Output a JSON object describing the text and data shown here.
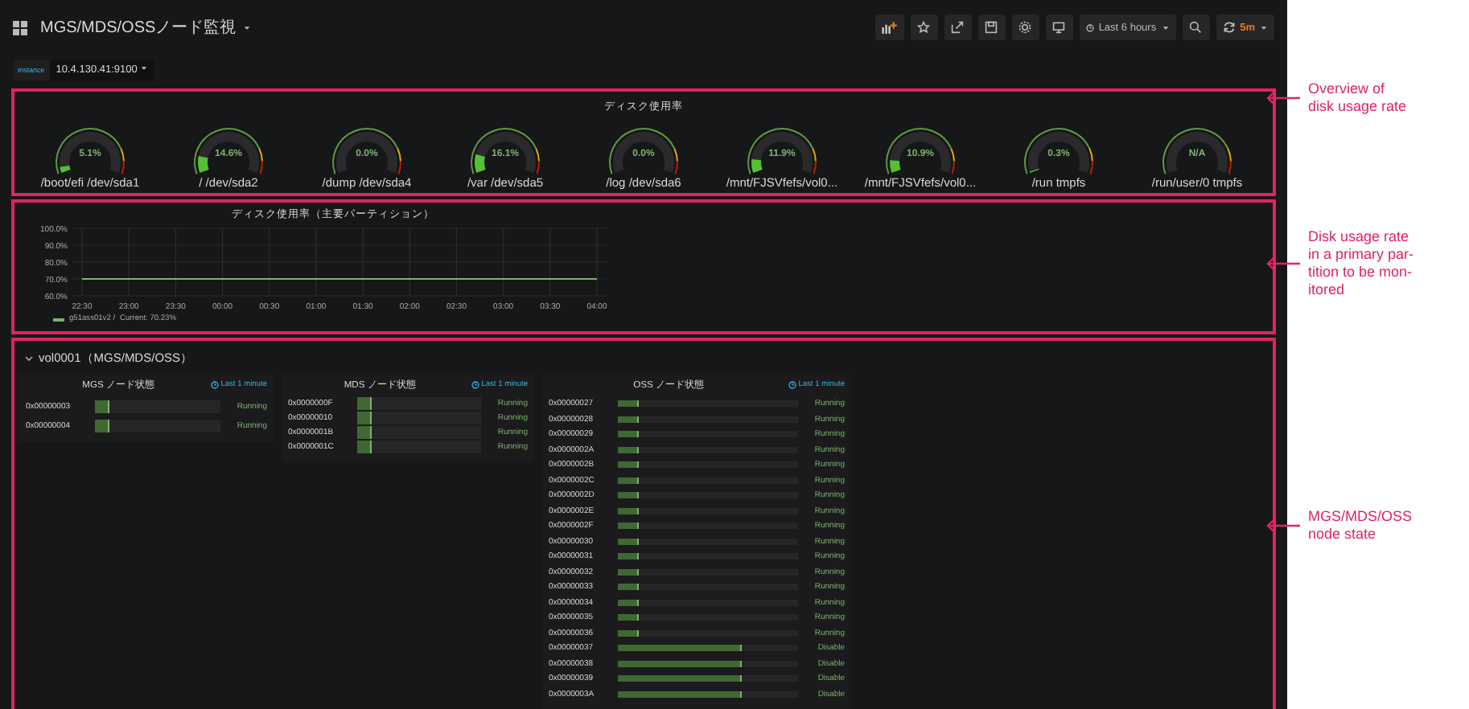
{
  "dashboard": {
    "title": "MGS/MDS/OSSノード監視",
    "toolbar": {
      "time_range": "Last 6 hours",
      "refresh": "5m"
    },
    "variables": [
      {
        "label": "instance",
        "value": "10.4.130.41:9100"
      }
    ],
    "gauge_panel": {
      "title": "ディスク使用率",
      "gauges": [
        {
          "value": "5.1%",
          "label": "/boot/efi /dev/sda1"
        },
        {
          "value": "14.6%",
          "label": "/ /dev/sda2"
        },
        {
          "value": "0.0%",
          "label": "/dump /dev/sda4"
        },
        {
          "value": "16.1%",
          "label": "/var /dev/sda5"
        },
        {
          "value": "0.0%",
          "label": "/log /dev/sda6"
        },
        {
          "value": "11.9%",
          "label": "/mnt/FJSVfefs/vol0..."
        },
        {
          "value": "10.9%",
          "label": "/mnt/FJSVfefs/vol0..."
        },
        {
          "value": "0.3%",
          "label": "/run tmpfs"
        },
        {
          "value": "N/A",
          "label": "/run/user/0 tmpfs"
        }
      ]
    },
    "chart_panel": {
      "title": "ディスク使用率（主要パーティション）",
      "current": "Current: 70.23%",
      "chart_data": {
        "type": "line",
        "categories": [
          "22:30",
          "23:00",
          "23:30",
          "00:00",
          "00:30",
          "01:00",
          "01:30",
          "02:00",
          "02:30",
          "03:00",
          "03:30",
          "04:00"
        ],
        "series": [
          {
            "name": "g51ass01v2 /",
            "color": "#7eb26d",
            "values": [
              70,
              70,
              70,
              70,
              70,
              70,
              70,
              70,
              70,
              70,
              70,
              70
            ]
          }
        ],
        "ylim": [
          60,
          100
        ],
        "grid": true,
        "yticks": [
          {
            "value": 60,
            "label": "60.0%"
          },
          {
            "value": 70,
            "label": "70.0%"
          },
          {
            "value": 80,
            "label": "80.0%"
          },
          {
            "value": 90,
            "label": "90.0%"
          },
          {
            "value": 100,
            "label": "100.0%"
          }
        ]
      }
    },
    "row": {
      "title": "vol0001（MGS/MDS/OSS）",
      "expanded": true,
      "panels": [
        {
          "title": "MGS ノード状態",
          "time": "Last 1 minute",
          "nodes": [
            {
              "id": "0x00000003",
              "level": 0.12,
              "status": "Running"
            },
            {
              "id": "0x00000004",
              "level": 0.12,
              "status": "Running"
            }
          ]
        },
        {
          "title": "MDS ノード状態",
          "time": "Last 1 minute",
          "nodes": [
            {
              "id": "0x0000000F",
              "level": 0.12,
              "status": "Running"
            },
            {
              "id": "0x00000010",
              "level": 0.12,
              "status": "Running"
            },
            {
              "id": "0x0000001B",
              "level": 0.12,
              "status": "Running"
            },
            {
              "id": "0x0000001C",
              "level": 0.12,
              "status": "Running"
            }
          ]
        },
        {
          "title": "OSS ノード状態",
          "time": "Last 1 minute",
          "nodes": [
            {
              "id": "0x00000027",
              "level": 0.12,
              "status": "Running"
            },
            {
              "id": "0x00000028",
              "level": 0.12,
              "status": "Running"
            },
            {
              "id": "0x00000029",
              "level": 0.12,
              "status": "Running"
            },
            {
              "id": "0x0000002A",
              "level": 0.12,
              "status": "Running"
            },
            {
              "id": "0x0000002B",
              "level": 0.12,
              "status": "Running"
            },
            {
              "id": "0x0000002C",
              "level": 0.12,
              "status": "Running"
            },
            {
              "id": "0x0000002D",
              "level": 0.12,
              "status": "Running"
            },
            {
              "id": "0x0000002E",
              "level": 0.12,
              "status": "Running"
            },
            {
              "id": "0x0000002F",
              "level": 0.12,
              "status": "Running"
            },
            {
              "id": "0x00000030",
              "level": 0.12,
              "status": "Running"
            },
            {
              "id": "0x00000031",
              "level": 0.12,
              "status": "Running"
            },
            {
              "id": "0x00000032",
              "level": 0.12,
              "status": "Running"
            },
            {
              "id": "0x00000033",
              "level": 0.12,
              "status": "Running"
            },
            {
              "id": "0x00000034",
              "level": 0.12,
              "status": "Running"
            },
            {
              "id": "0x00000035",
              "level": 0.12,
              "status": "Running"
            },
            {
              "id": "0x00000036",
              "level": 0.12,
              "status": "Running"
            },
            {
              "id": "0x00000037",
              "level": 0.69,
              "status": "Disable"
            },
            {
              "id": "0x00000038",
              "level": 0.69,
              "status": "Disable"
            },
            {
              "id": "0x00000039",
              "level": 0.69,
              "status": "Disable"
            },
            {
              "id": "0x0000003A",
              "level": 0.69,
              "status": "Disable"
            }
          ]
        }
      ]
    }
  },
  "callouts": [
    {
      "lines": [
        "Overview of",
        "disk usage rate"
      ]
    },
    {
      "lines": [
        "Disk usage rate",
        "in a primary par-",
        "tition to be mon-",
        "itored"
      ]
    },
    {
      "lines": [
        "MGS/MDS/OSS",
        "node state"
      ]
    }
  ]
}
